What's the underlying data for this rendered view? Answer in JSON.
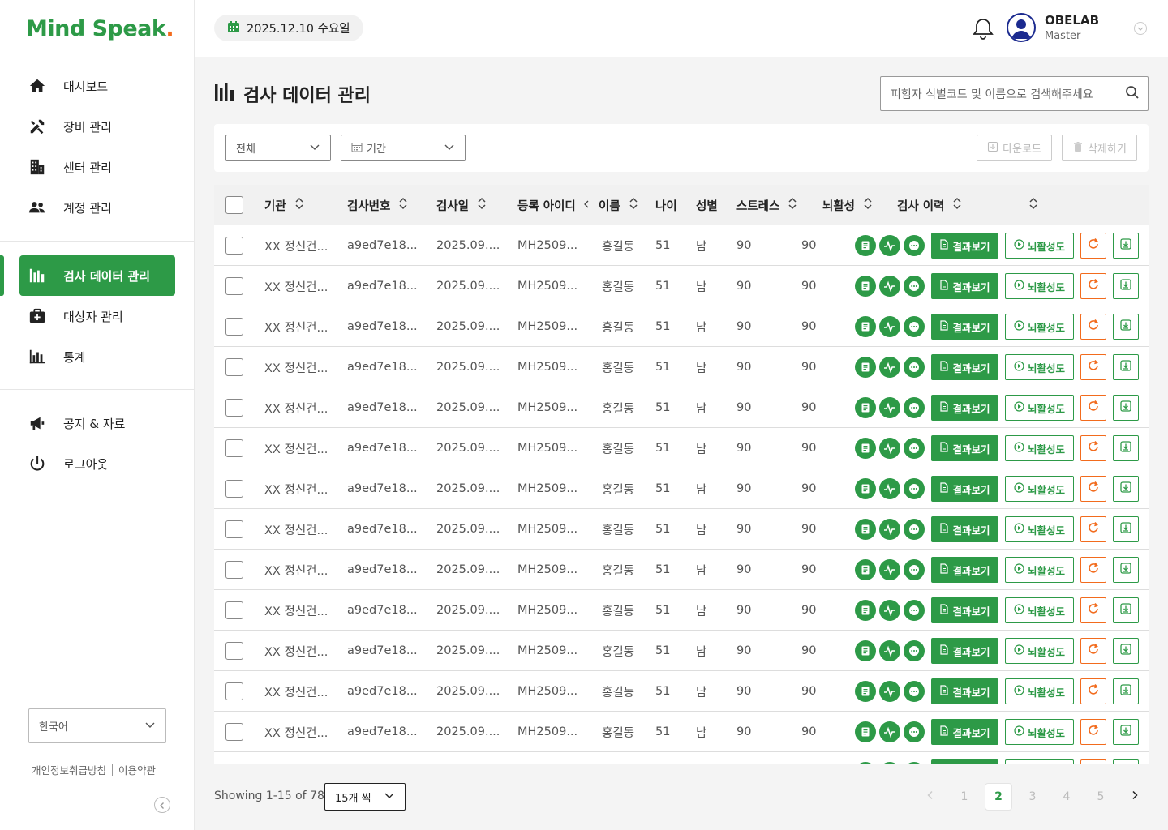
{
  "brand": {
    "name": "Mind Speak",
    "dot": "."
  },
  "sidebar": {
    "items": [
      {
        "label": "대시보드",
        "icon": "home-icon"
      },
      {
        "label": "장비 관리",
        "icon": "tools-icon"
      },
      {
        "label": "센터 관리",
        "icon": "building-icon"
      },
      {
        "label": "계정 관리",
        "icon": "users-icon"
      },
      {
        "label": "검사 데이터 관리",
        "icon": "bar-data-icon",
        "active": true
      },
      {
        "label": "대상자 관리",
        "icon": "medkit-icon"
      },
      {
        "label": "통계",
        "icon": "chart-icon"
      },
      {
        "label": "공지 & 자료",
        "icon": "megaphone-icon"
      },
      {
        "label": "로그아웃",
        "icon": "power-icon"
      }
    ],
    "language": "한국어",
    "privacy": "개인정보취급방침",
    "terms": "이용약관"
  },
  "topbar": {
    "date": "2025.12.10 수요일",
    "user_name": "OBELAB",
    "user_role": "Master"
  },
  "page": {
    "title": "검사 데이터 관리",
    "search_placeholder": "피험자 식별코드 및 이름으로 검색해주세요",
    "filter_all": "전체",
    "filter_period": "기간",
    "download": "다운로드",
    "delete": "삭제하기"
  },
  "table": {
    "headers": [
      "기관",
      "검사번호",
      "검사일",
      "등록 아이디",
      "이름",
      "나이",
      "성별",
      "스트레스",
      "뇌활성",
      "검사 이력"
    ],
    "rows": [
      [
        "XX 정신건...",
        "a9ed7e18...",
        "2025.09....",
        "MH2509...",
        "홍길동",
        "51",
        "남",
        "90",
        "90"
      ],
      [
        "XX 정신건...",
        "a9ed7e18...",
        "2025.09....",
        "MH2509...",
        "홍길동",
        "51",
        "남",
        "90",
        "90"
      ],
      [
        "XX 정신건...",
        "a9ed7e18...",
        "2025.09....",
        "MH2509...",
        "홍길동",
        "51",
        "남",
        "90",
        "90"
      ],
      [
        "XX 정신건...",
        "a9ed7e18...",
        "2025.09....",
        "MH2509...",
        "홍길동",
        "51",
        "남",
        "90",
        "90"
      ],
      [
        "XX 정신건...",
        "a9ed7e18...",
        "2025.09....",
        "MH2509...",
        "홍길동",
        "51",
        "남",
        "90",
        "90"
      ],
      [
        "XX 정신건...",
        "a9ed7e18...",
        "2025.09....",
        "MH2509...",
        "홍길동",
        "51",
        "남",
        "90",
        "90"
      ],
      [
        "XX 정신건...",
        "a9ed7e18...",
        "2025.09....",
        "MH2509...",
        "홍길동",
        "51",
        "남",
        "90",
        "90"
      ],
      [
        "XX 정신건...",
        "a9ed7e18...",
        "2025.09....",
        "MH2509...",
        "홍길동",
        "51",
        "남",
        "90",
        "90"
      ],
      [
        "XX 정신건...",
        "a9ed7e18...",
        "2025.09....",
        "MH2509...",
        "홍길동",
        "51",
        "남",
        "90",
        "90"
      ],
      [
        "XX 정신건...",
        "a9ed7e18...",
        "2025.09....",
        "MH2509...",
        "홍길동",
        "51",
        "남",
        "90",
        "90"
      ],
      [
        "XX 정신건...",
        "a9ed7e18...",
        "2025.09....",
        "MH2509...",
        "홍길동",
        "51",
        "남",
        "90",
        "90"
      ],
      [
        "XX 정신건...",
        "a9ed7e18...",
        "2025.09....",
        "MH2509...",
        "홍길동",
        "51",
        "남",
        "90",
        "90"
      ],
      [
        "XX 정신건...",
        "a9ed7e18...",
        "2025.09....",
        "MH2509...",
        "홍길동",
        "51",
        "남",
        "90",
        "90"
      ]
    ],
    "result_button": "결과보기",
    "brain_button": "뇌활성도"
  },
  "pagination": {
    "showing": "Showing 1-15 of 78",
    "page_size": "15개 씩",
    "pages": [
      "1",
      "2",
      "3",
      "4",
      "5"
    ],
    "current": "2"
  },
  "colors": {
    "accent": "#2d9a47",
    "orange": "#f26b1d",
    "navy": "#1b2a8f"
  }
}
